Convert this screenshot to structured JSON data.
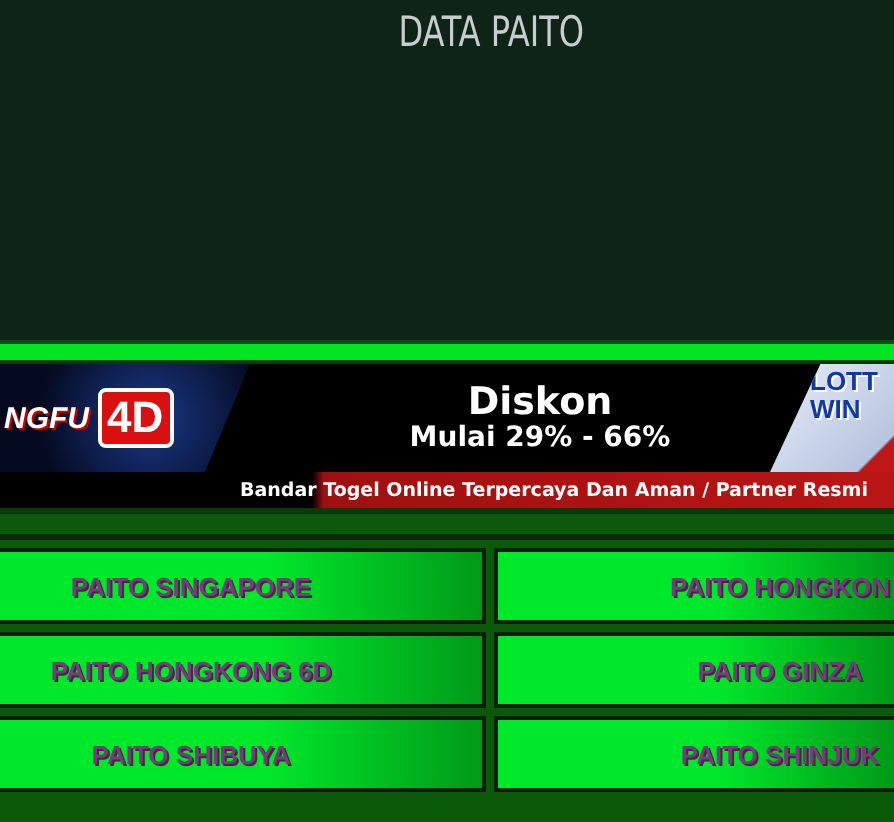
{
  "header": {
    "title": "DATA PAITO"
  },
  "banner": {
    "logo_left": "NGFU",
    "logo_badge": "4D",
    "headline": "Diskon",
    "subline": "Mulai 29% - 66%",
    "logo_right_top": "LOTT",
    "logo_right_bottom": "WIN",
    "footer": "Bandar Togel Online Terpercaya Dan Aman / Partner Resmi"
  },
  "links": [
    {
      "label": "PAITO SINGAPORE"
    },
    {
      "label": "PAITO HONGKON"
    },
    {
      "label": "PAITO HONGKONG 6D"
    },
    {
      "label": "PAITO GINZA"
    },
    {
      "label": "PAITO SHIBUYA"
    },
    {
      "label": "PAITO SHINJUK"
    }
  ]
}
